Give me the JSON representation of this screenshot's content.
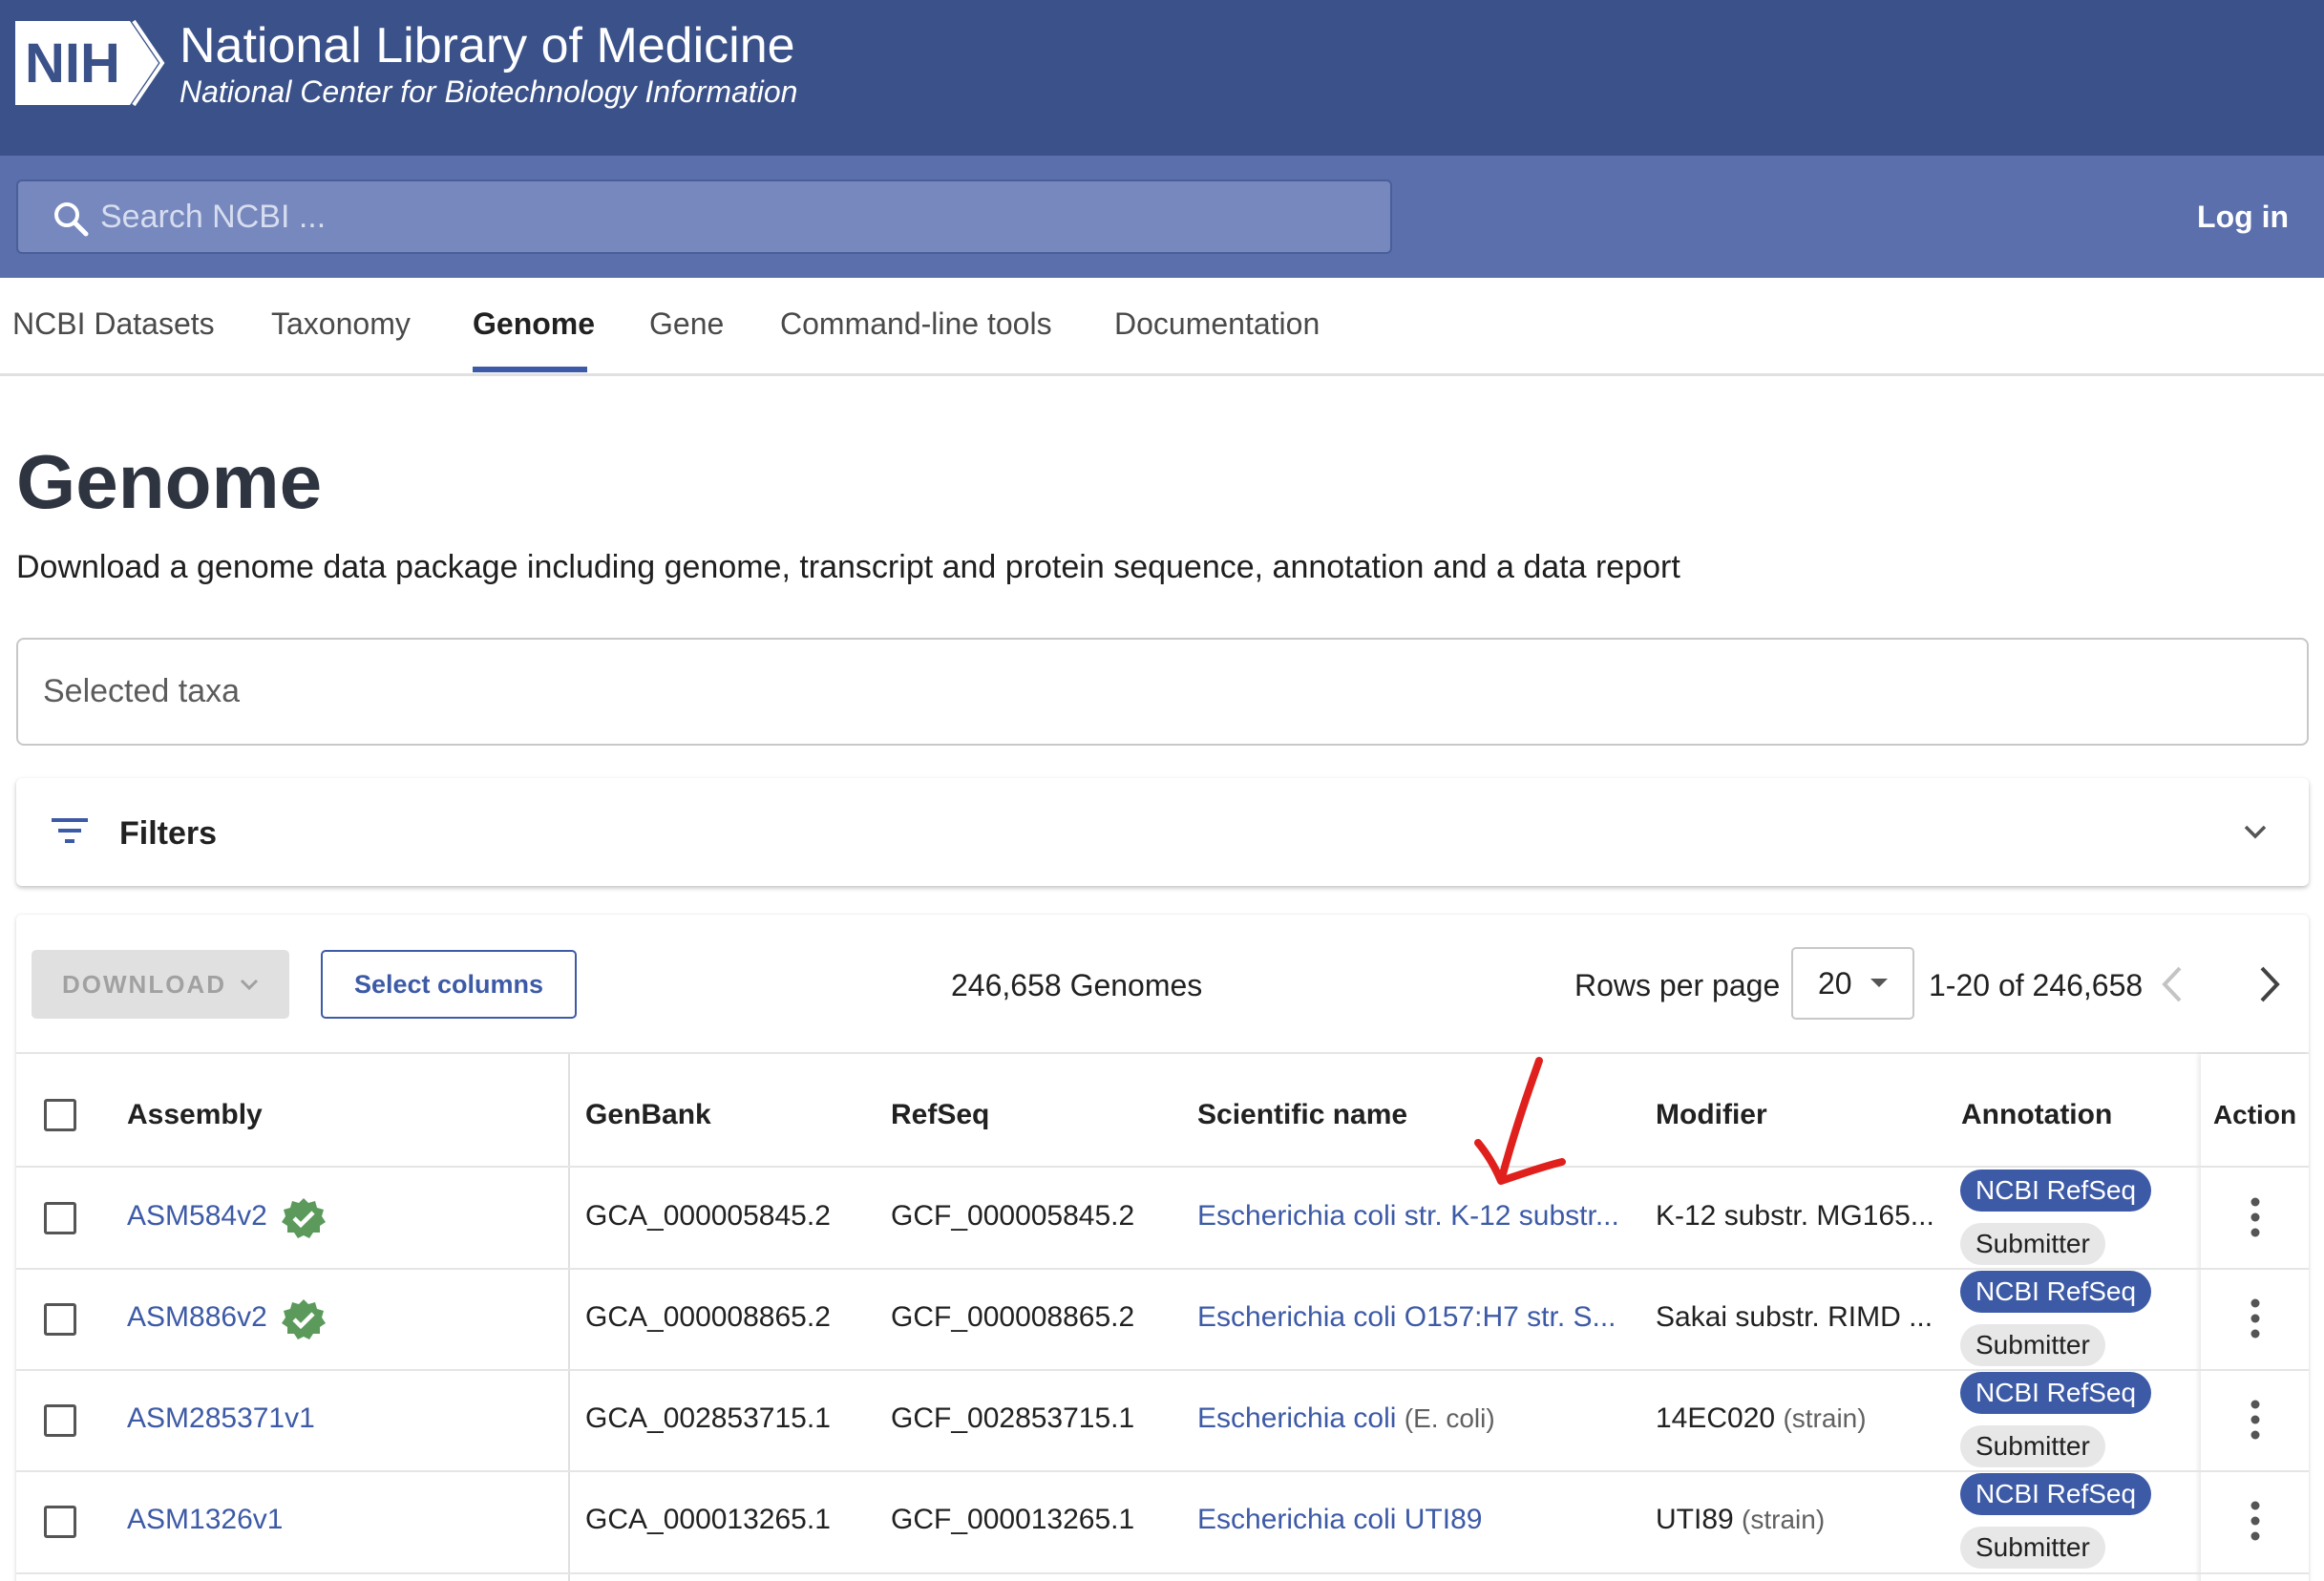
{
  "header": {
    "logo_text": "NIH",
    "org_title": "National Library of Medicine",
    "org_subtitle": "National Center for Biotechnology Information"
  },
  "search": {
    "placeholder": "Search NCBI ...",
    "login_label": "Log in"
  },
  "nav": {
    "items": [
      {
        "label": "NCBI Datasets"
      },
      {
        "label": "Taxonomy"
      },
      {
        "label": "Genome",
        "active": true
      },
      {
        "label": "Gene"
      },
      {
        "label": "Command-line tools"
      },
      {
        "label": "Documentation"
      }
    ]
  },
  "page": {
    "title": "Genome",
    "description": "Download a genome data package including genome, transcript and protein sequence, annotation and a data report"
  },
  "taxa": {
    "placeholder": "Selected taxa"
  },
  "filters": {
    "label": "Filters"
  },
  "toolbar": {
    "download_label": "DOWNLOAD",
    "select_columns_label": "Select columns",
    "genome_count": "246,658 Genomes",
    "rows_per_page_label": "Rows per page",
    "rows_per_page_value": "20",
    "range_label": "1-20 of 246,658"
  },
  "table": {
    "columns": [
      "Assembly",
      "GenBank",
      "RefSeq",
      "Scientific name",
      "Modifier",
      "Annotation",
      "Action"
    ],
    "rows": [
      {
        "assembly": "ASM584v2",
        "verified": true,
        "genbank": "GCA_000005845.2",
        "refseq": "GCF_000005845.2",
        "sci_name": "Escherichia coli str. K-12 substr...",
        "sci_suffix": "",
        "modifier": "K-12 substr. MG165...",
        "modifier_suffix": "",
        "annotations": [
          "NCBI RefSeq",
          "Submitter"
        ]
      },
      {
        "assembly": "ASM886v2",
        "verified": true,
        "genbank": "GCA_000008865.2",
        "refseq": "GCF_000008865.2",
        "sci_name": "Escherichia coli O157:H7 str. S...",
        "sci_suffix": "",
        "modifier": "Sakai substr. RIMD ...",
        "modifier_suffix": "",
        "annotations": [
          "NCBI RefSeq",
          "Submitter"
        ]
      },
      {
        "assembly": "ASM285371v1",
        "verified": false,
        "genbank": "GCA_002853715.1",
        "refseq": "GCF_002853715.1",
        "sci_name": "Escherichia coli",
        "sci_suffix": "(E. coli)",
        "modifier": "14EC020",
        "modifier_suffix": "(strain)",
        "annotations": [
          "NCBI RefSeq",
          "Submitter"
        ]
      },
      {
        "assembly": "ASM1326v1",
        "verified": false,
        "genbank": "GCA_000013265.1",
        "refseq": "GCF_000013265.1",
        "sci_name": "Escherichia coli UTI89",
        "sci_suffix": "",
        "modifier": "UTI89",
        "modifier_suffix": "(strain)",
        "annotations": [
          "NCBI RefSeq",
          "Submitter"
        ]
      }
    ]
  },
  "colors": {
    "banner": "#3a5189",
    "searchbar": "#5a6fac",
    "accent": "#3d5aa6",
    "verified": "#5c9a5c",
    "annotation_mark": "#e0201c"
  },
  "icons": [
    "search-icon",
    "filter-icon",
    "chevron-down-icon",
    "chevron-left-icon",
    "chevron-right-icon",
    "verified-badge-icon",
    "more-vert-icon"
  ]
}
